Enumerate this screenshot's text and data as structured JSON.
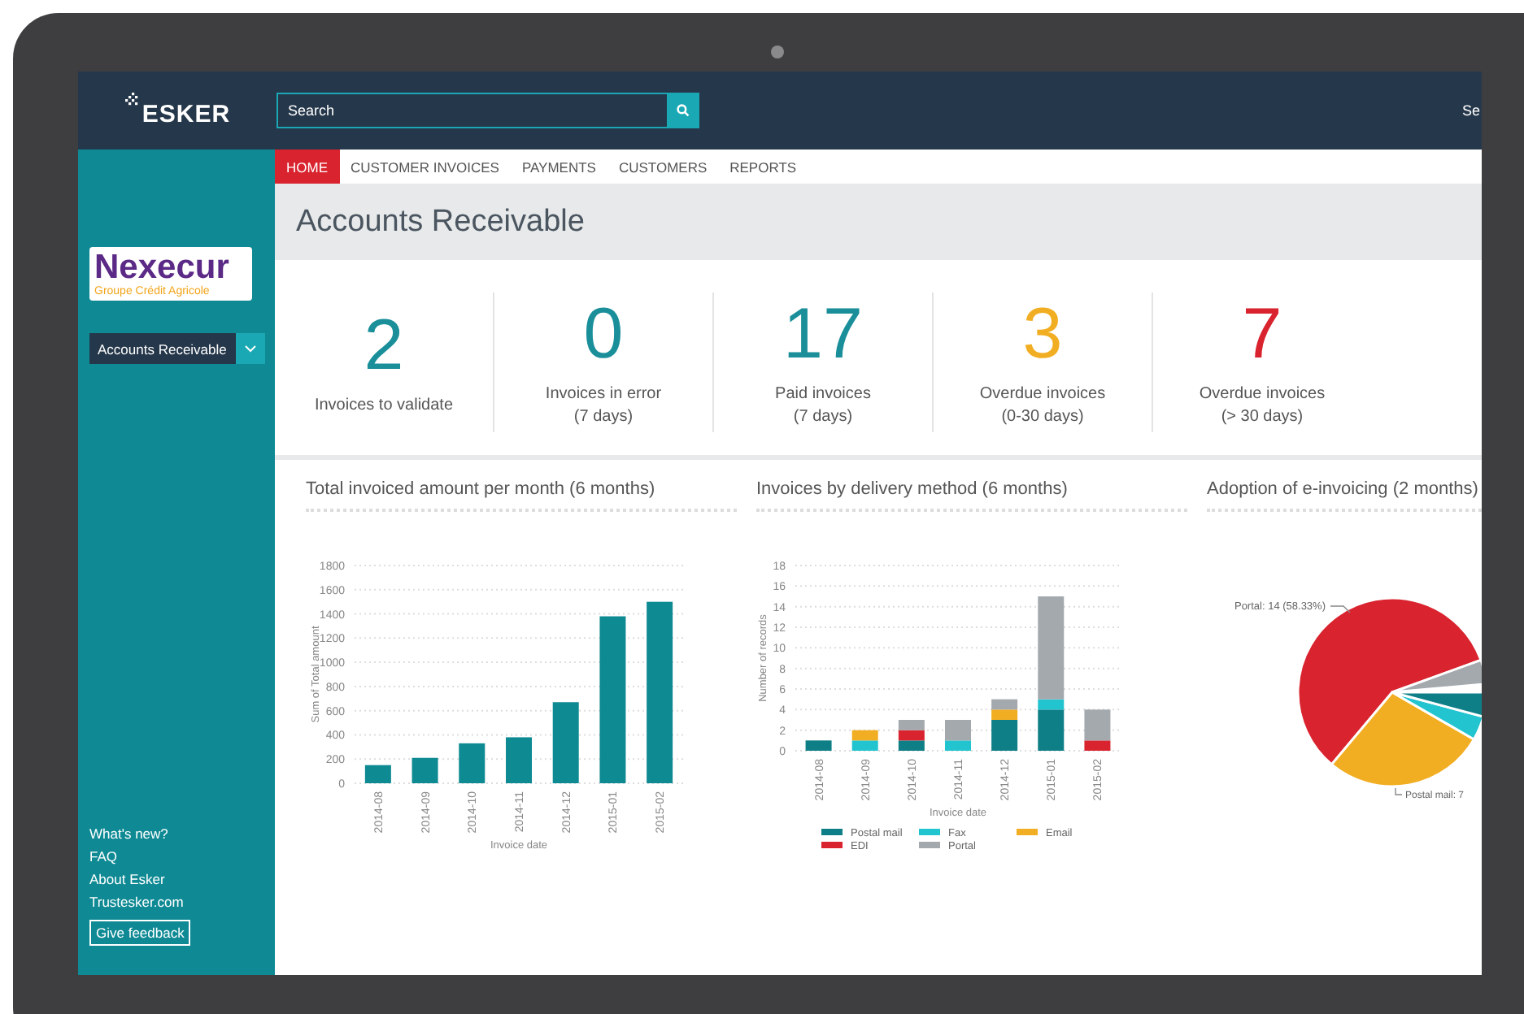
{
  "header": {
    "logo": "ESKER",
    "search": {
      "placeholder": "Search"
    },
    "user_text": "Se"
  },
  "sidebar": {
    "partner_logo": {
      "name": "Nexecur",
      "tagline": "Groupe Crédit Agricole"
    },
    "selector": "Accounts Receivable",
    "links": [
      "What's new?",
      "FAQ",
      "About Esker",
      "Trustesker.com"
    ],
    "feedback_button": "Give feedback"
  },
  "nav": [
    {
      "label": "HOME",
      "selected": true
    },
    {
      "label": "CUSTOMER INVOICES",
      "selected": false
    },
    {
      "label": "PAYMENTS",
      "selected": false
    },
    {
      "label": "CUSTOMERS",
      "selected": false
    },
    {
      "label": "REPORTS",
      "selected": false
    }
  ],
  "page_title": "Accounts Receivable",
  "kpis": [
    {
      "value": "2",
      "label": "Invoices to validate",
      "color": "#1a8f9a"
    },
    {
      "value": "0",
      "label": "Invoices in error\n(7 days)",
      "color": "#1a8f9a"
    },
    {
      "value": "17",
      "label": "Paid invoices\n(7 days)",
      "color": "#1a8f9a"
    },
    {
      "value": "3",
      "label": "Overdue invoices\n(0-30 days)",
      "color": "#f2ae22"
    },
    {
      "value": "7",
      "label": "Overdue invoices\n(> 30 days)",
      "color": "#d9232e"
    }
  ],
  "charts": [
    {
      "kind": "bar",
      "chart_data": {
        "type": "bar",
        "title": "Total invoiced amount per month (6 months)",
        "xlabel": "Invoice date",
        "ylabel": "Sum of Total amount",
        "categories": [
          "2014-08",
          "2014-09",
          "2014-10",
          "2014-11",
          "2014-12",
          "2015-01",
          "2015-02"
        ],
        "values": [
          150,
          210,
          330,
          380,
          670,
          1380,
          1500
        ],
        "ylim": [
          0,
          1800
        ],
        "grid": true,
        "yticks": [
          0,
          200,
          400,
          600,
          800,
          1000,
          1200,
          1400,
          1600,
          1800
        ]
      }
    },
    {
      "kind": "stacked",
      "chart_data": {
        "type": "bar",
        "stacked": true,
        "title": "Invoices by delivery method (6 months)",
        "xlabel": "Invoice date",
        "ylabel": "Number of records",
        "categories": [
          "2014-08",
          "2014-09",
          "2014-10",
          "2014-11",
          "2014-12",
          "2015-01",
          "2015-02"
        ],
        "ylim": [
          0,
          18
        ],
        "yticks": [
          0,
          2,
          4,
          6,
          8,
          10,
          12,
          14,
          16,
          18
        ],
        "grid": true,
        "legend": true,
        "series": [
          {
            "name": "Postal mail",
            "color": "#0e7f86",
            "values": [
              1,
              0,
              1,
              0,
              3,
              4,
              0
            ]
          },
          {
            "name": "Fax",
            "color": "#22c4cf",
            "values": [
              0,
              1,
              0,
              1,
              0,
              1,
              0
            ]
          },
          {
            "name": "Email",
            "color": "#f2ae22",
            "values": [
              0,
              1,
              0,
              0,
              1,
              0,
              0
            ]
          },
          {
            "name": "EDI",
            "color": "#d9232e",
            "values": [
              0,
              0,
              1,
              0,
              0,
              0,
              1
            ]
          },
          {
            "name": "Portal",
            "color": "#a4a9ae",
            "values": [
              0,
              0,
              1,
              2,
              1,
              10,
              3
            ]
          }
        ]
      }
    },
    {
      "kind": "pie",
      "title": "Adoption of e-invoicing (2 months)",
      "labels": [
        "Portal: 14 (58.33%)",
        "Postal mail: 7"
      ]
    }
  ]
}
